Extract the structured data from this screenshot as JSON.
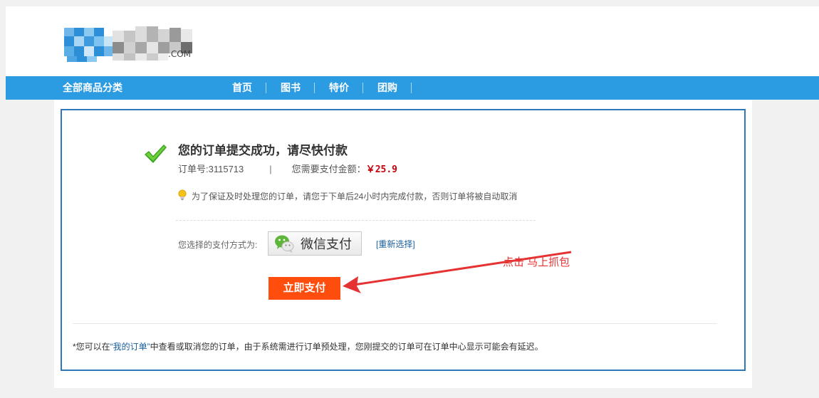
{
  "header": {
    "logo_suffix": ".COM",
    "logo_colors": {
      "blue": "#2d8fd8",
      "light_blue": "#7ec3ef",
      "gray": "#b9b9b9",
      "dark_gray": "#777777"
    }
  },
  "nav": {
    "all_categories": "全部商品分类",
    "links": [
      "首页",
      "图书",
      "特价",
      "团购"
    ],
    "color": "#2b9be2"
  },
  "order": {
    "success_title": "您的订单提交成功，请尽快付款",
    "order_no_label": "订单号:",
    "order_no": "3115713",
    "separator": "|",
    "amount_label": "您需要支付金额：",
    "amount": "￥25.9",
    "tip": "为了保证及时处理您的订单，请您于下单后24小时内完成付款，否则订单将被自动取消",
    "payment_method_label": "您选择的支付方式为:",
    "payment_method": "微信支付",
    "rechoose": "[重新选择]",
    "pay_now": "立即支付",
    "annotation": "点击 马上抓包",
    "note_prefix": "*您可以在",
    "note_link": "“我的订单”",
    "note_suffix": "中查看或取消您的订单，由于系统需进行订单预处理，您刚提交的订单可在订单中心显示可能会有延迟。"
  },
  "colors": {
    "accent": "#2b9be2",
    "box_border": "#2f78b7",
    "price": "#c7000b",
    "pay_button": "#ff4d0d",
    "annotation": "#e53333",
    "check": "#3aa41f"
  },
  "icons": {
    "check": "check-icon",
    "bulb": "bulb-icon",
    "wechat": "wechat-icon",
    "arrow": "arrow-annotation"
  }
}
